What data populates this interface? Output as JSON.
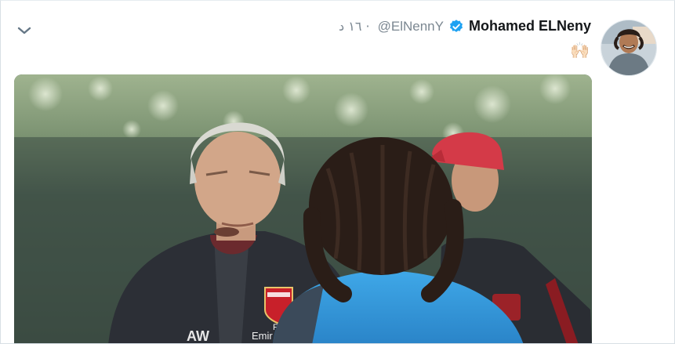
{
  "tweet": {
    "display_name": "Mohamed ELNeny",
    "handle": "@ElNennY",
    "time_ago": "١٦ د ·",
    "text_emoji": "🙌🏻",
    "icons": {
      "menu": "chevron-down-icon",
      "verified": "verified-badge-icon"
    },
    "colors": {
      "verified": "#1da1f2",
      "name": "#14171a",
      "meta": "#7b8791"
    }
  },
  "photo": {
    "jacket_text": "Fly\nEmir",
    "initials": "AW",
    "badge_text": "Arsenal"
  }
}
